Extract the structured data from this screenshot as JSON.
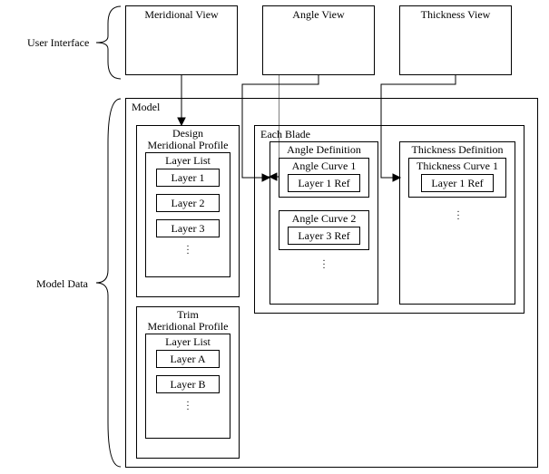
{
  "ui": {
    "label": "User Interface",
    "views": {
      "meridional": "Meridional View",
      "angle": "Angle View",
      "thickness": "Thickness View"
    }
  },
  "model_data": {
    "label": "Model Data",
    "model": {
      "label": "Model",
      "design": {
        "title_line1": "Design",
        "title_line2": "Meridional Profile",
        "layer_list": {
          "label": "Layer List",
          "layers": [
            "Layer 1",
            "Layer 2",
            "Layer 3"
          ]
        }
      },
      "trim": {
        "title_line1": "Trim",
        "title_line2": "Meridional Profile",
        "layer_list": {
          "label": "Layer List",
          "layers": [
            "Layer A",
            "Layer B"
          ]
        }
      },
      "each_blade": {
        "label": "Each Blade",
        "angle_def": {
          "label": "Angle Definition",
          "curves": [
            {
              "name": "Angle Curve 1",
              "ref": "Layer 1 Ref"
            },
            {
              "name": "Angle Curve 2",
              "ref": "Layer 3 Ref"
            }
          ]
        },
        "thickness_def": {
          "label": "Thickness Definition",
          "curves": [
            {
              "name": "Thickness Curve 1",
              "ref": "Layer 1 Ref"
            }
          ]
        }
      }
    }
  }
}
